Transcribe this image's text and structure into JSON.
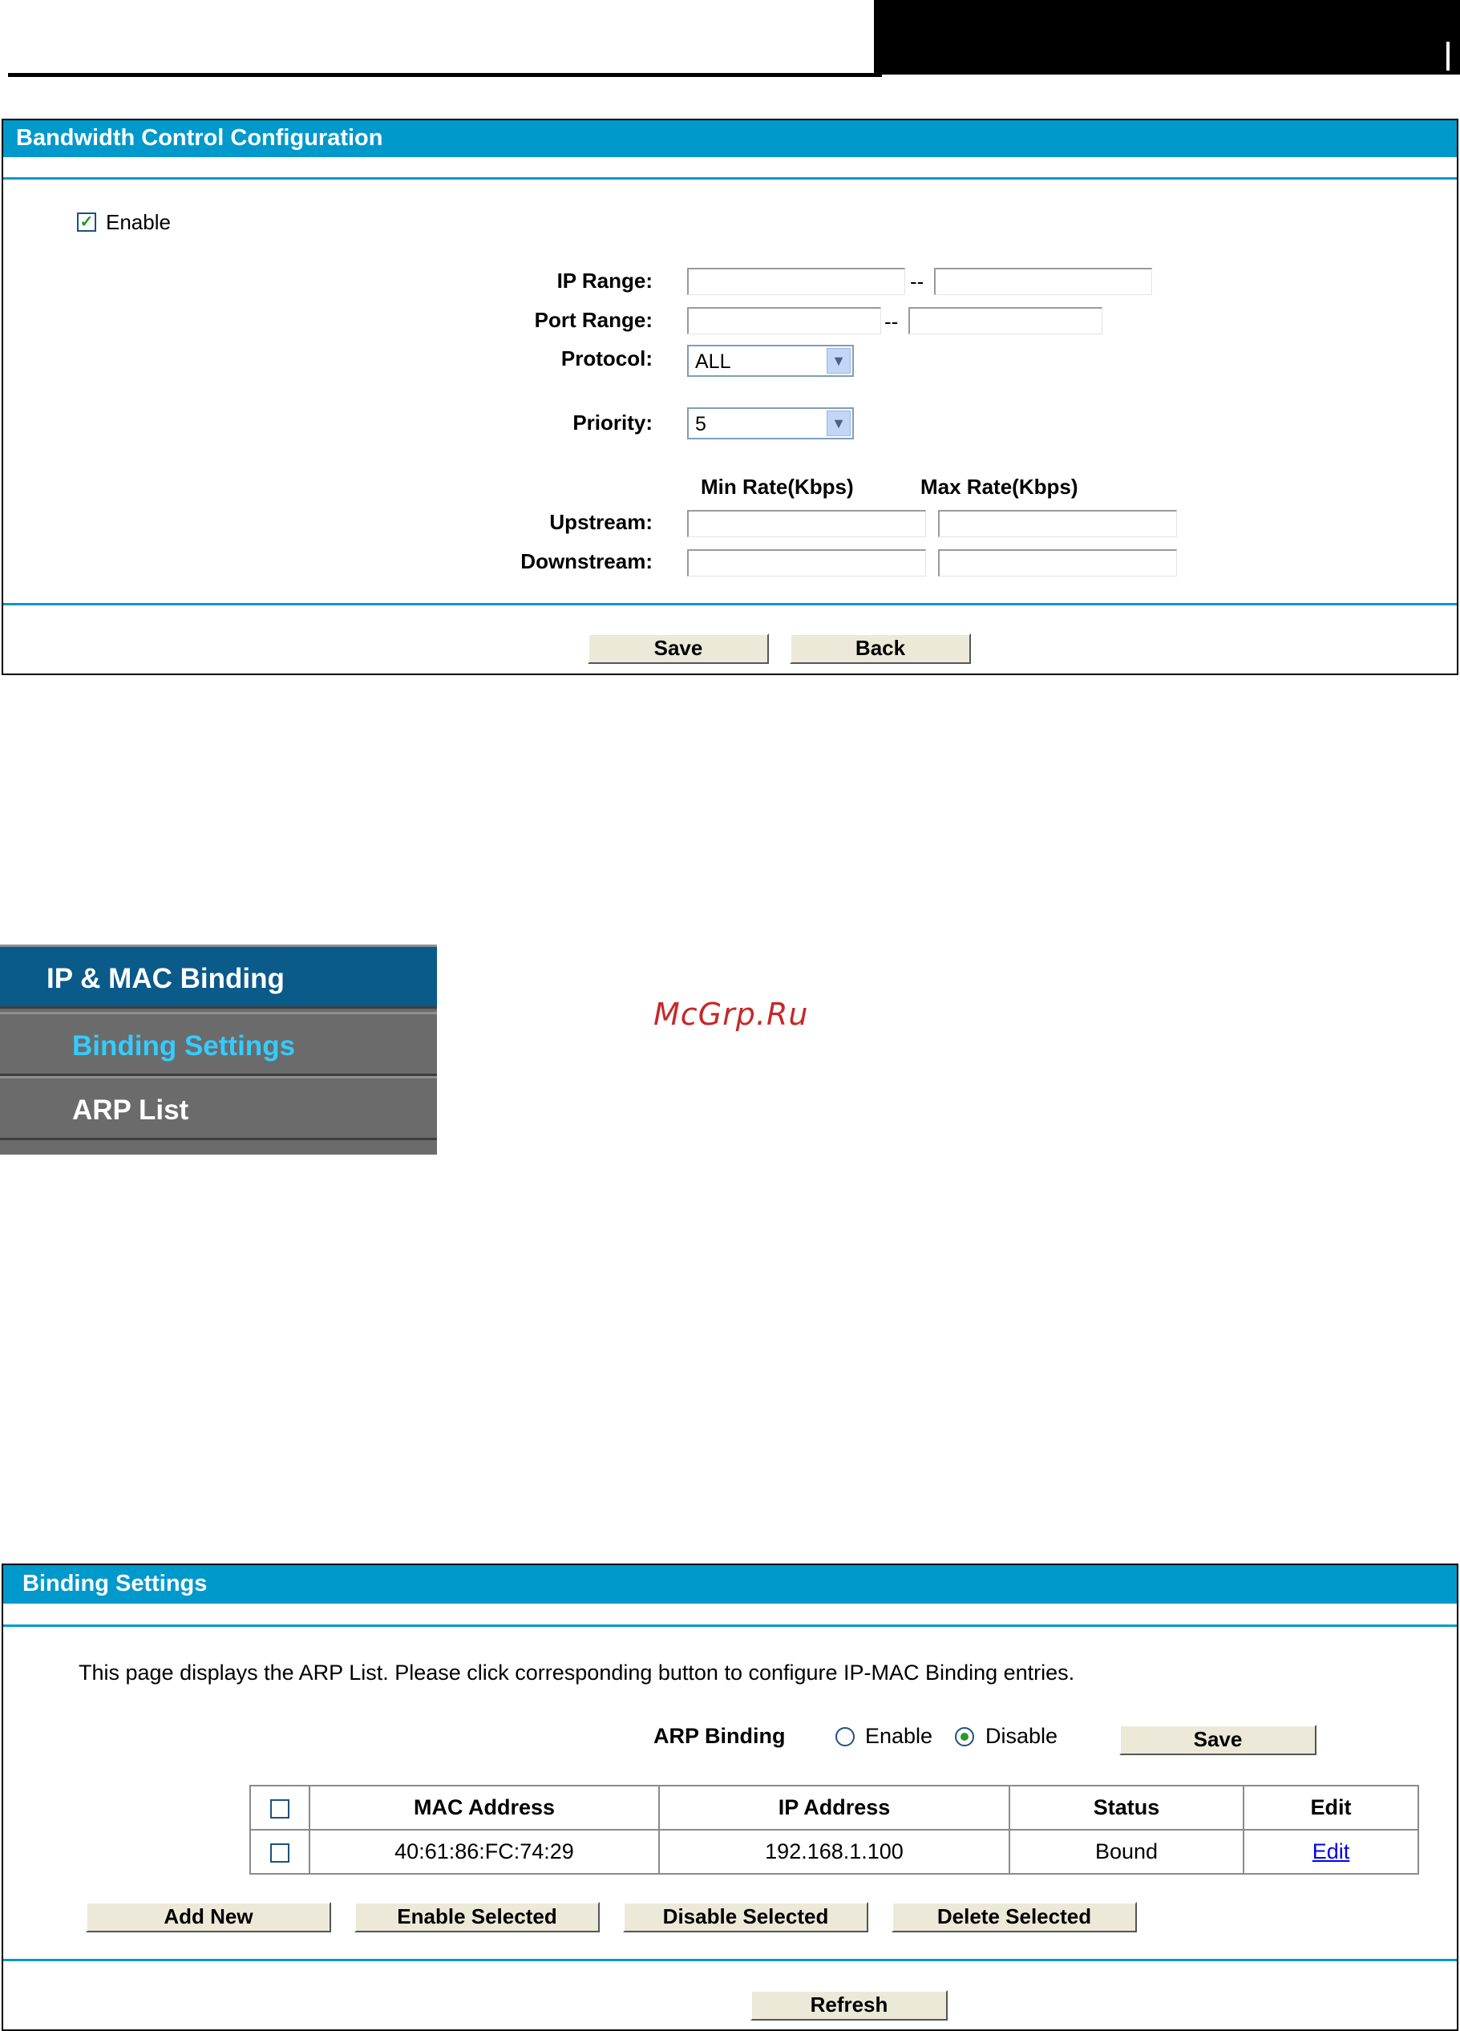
{
  "bandwidth": {
    "title": "Bandwidth Control Configuration",
    "enable_label": "Enable",
    "enable_checked": true,
    "ip_range_label": "IP Range:",
    "port_range_label": "Port Range:",
    "range_sep": "--",
    "protocol_label": "Protocol:",
    "protocol_value": "ALL",
    "priority_label": "Priority:",
    "priority_value": "5",
    "min_rate_header": "Min Rate(Kbps)",
    "max_rate_header": "Max Rate(Kbps)",
    "upstream_label": "Upstream:",
    "downstream_label": "Downstream:",
    "save_label": "Save",
    "back_label": "Back"
  },
  "menu": {
    "items": [
      {
        "label": "IP & MAC Binding",
        "color": "#ffffff",
        "bg": "#0a5a8a"
      },
      {
        "label": "Binding Settings",
        "color": "#33ccff",
        "bg": "#6b6b6b"
      },
      {
        "label": "ARP List",
        "color": "#ffffff",
        "bg": "#6b6b6b"
      }
    ]
  },
  "watermark": "McGrp.Ru",
  "binding": {
    "title": "Binding Settings",
    "description": "This page displays the ARP List. Please click corresponding button to configure IP-MAC Binding entries.",
    "arp_binding_label": "ARP Binding",
    "enable_label": "Enable",
    "disable_label": "Disable",
    "selected": "Disable",
    "save_label": "Save",
    "table": {
      "headers": [
        "MAC Address",
        "IP Address",
        "Status",
        "Edit"
      ],
      "rows": [
        {
          "mac": "40:61:86:FC:74:29",
          "ip": "192.168.1.100",
          "status": "Bound",
          "edit": "Edit"
        }
      ]
    },
    "add_new_label": "Add New",
    "enable_selected_label": "Enable Selected",
    "disable_selected_label": "Disable Selected",
    "delete_selected_label": "Delete Selected",
    "refresh_label": "Refresh"
  },
  "colors": {
    "accent": "#0099cc"
  }
}
